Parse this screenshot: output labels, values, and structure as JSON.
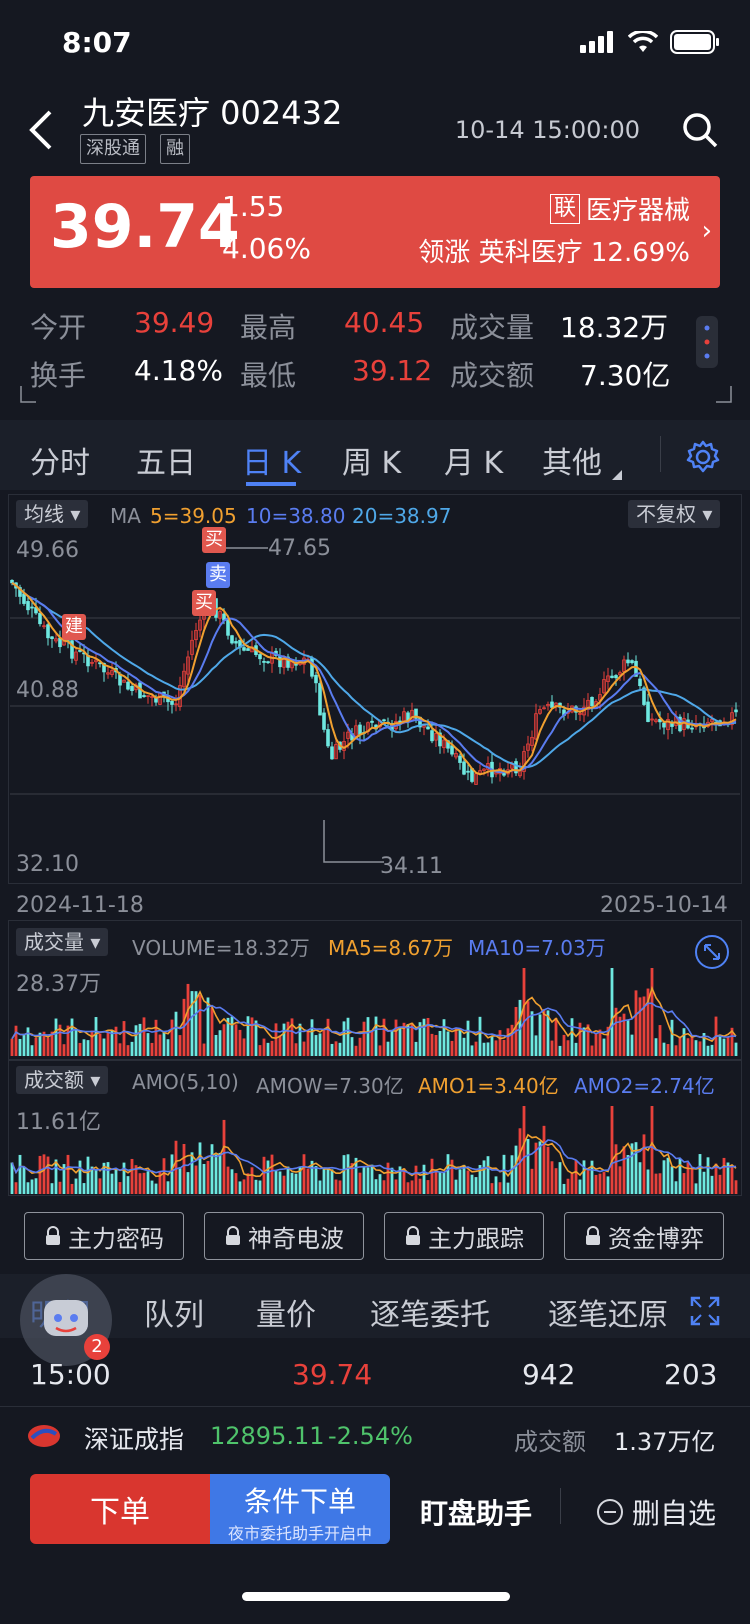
{
  "status": {
    "time": "8:07"
  },
  "header": {
    "title": "九安医疗 002432",
    "tags": [
      "深股通",
      "融"
    ],
    "datetime": "10-14 15:00:00"
  },
  "banner": {
    "price": "39.74",
    "change": "1.55",
    "change_pct": "4.06%",
    "sector_badge": "联",
    "sector": "医疗器械",
    "lead_label": "领涨",
    "lead_stock": "英科医疗",
    "lead_pct": "12.69%"
  },
  "stats": {
    "open_label": "今开",
    "open": "39.49",
    "high_label": "最高",
    "high": "40.45",
    "volume_label": "成交量",
    "volume": "18.32万",
    "turnover_label": "换手",
    "turnover": "4.18%",
    "low_label": "最低",
    "low": "39.12",
    "amount_label": "成交额",
    "amount": "7.30亿"
  },
  "ktabs": [
    "分时",
    "五日",
    "日 K",
    "周 K",
    "月 K",
    "其他"
  ],
  "active_ktab": "日 K",
  "chart": {
    "ma_selector": "均线",
    "ma_label": "MA",
    "ma5": "5=39.05",
    "ma10": "10=38.80",
    "ma20": "20=38.97",
    "adjust": "不复权",
    "y_top": "49.66",
    "y_mid": "40.88",
    "y_bottom": "32.10",
    "high_mark": "47.65",
    "low_mark": "34.11",
    "date_start": "2024-11-18",
    "date_end": "2025-10-14",
    "markers": {
      "build": "建",
      "buy": "买",
      "sell": "卖"
    },
    "colors": {
      "up": "#e8413b",
      "down": "#6ee8e0",
      "ma5": "#f0a030",
      "ma10": "#5a7cf0",
      "ma20": "#4fa8e8"
    }
  },
  "volume_panel": {
    "selector": "成交量",
    "volume": "VOLUME=18.32万",
    "ma5": "MA5=8.67万",
    "ma10": "MA10=7.03万",
    "max": "28.37万"
  },
  "amount_panel": {
    "selector": "成交额",
    "amo": "AMO(5,10)",
    "amow": "AMOW=7.30亿",
    "amo1": "AMO1=3.40亿",
    "amo2": "AMO2=2.74亿",
    "max": "11.61亿"
  },
  "tools": [
    "主力密码",
    "神奇电波",
    "主力跟踪",
    "资金博弈"
  ],
  "detail_tabs": [
    "明细",
    "队列",
    "量价",
    "逐笔委托",
    "逐笔还原"
  ],
  "trade_row": {
    "time": "15:00",
    "price": "39.74",
    "volume": "942",
    "count": "203",
    "badge": "2"
  },
  "index_bar": {
    "name": "深证成指",
    "value": "12895.11",
    "pct": "-2.54%",
    "amount_label": "成交额",
    "amount": "1.37万亿"
  },
  "bottom": {
    "order": "下单",
    "cond": "条件下单",
    "cond_sub": "夜市委托助手开启中",
    "assist": "盯盘助手",
    "remove": "删自选"
  }
}
